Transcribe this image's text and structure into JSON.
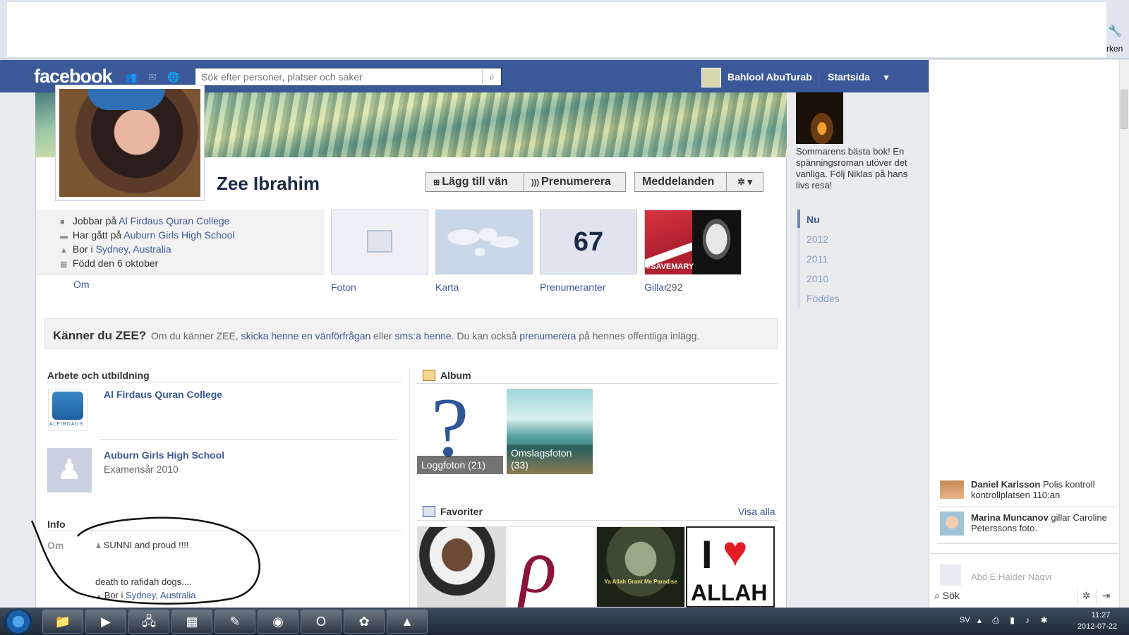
{
  "browser": {
    "wrench_icon": "wrench-icon",
    "partial_label": "rken"
  },
  "topbar": {
    "logo": "facebook",
    "search_placeholder": "Sök efter personer, platser och saker",
    "user_name": "Bahlool AbuTurab",
    "home": "Startsida",
    "brand_color": "#3b5998"
  },
  "profile": {
    "name": "Zee Ibrahim",
    "buttons": {
      "add_friend": "Lägg till vän",
      "subscribe": "Prenumerera",
      "messages": "Meddelanden"
    },
    "intro": [
      {
        "prefix": "Jobbar på ",
        "link": "Al Firdaus Quran College"
      },
      {
        "prefix": "Har gått på ",
        "link": "Auburn Girls High School"
      },
      {
        "prefix": "Bor i ",
        "link": "Sydney, Australia"
      },
      {
        "prefix": "Född den 6 oktober",
        "link": ""
      }
    ],
    "om_link": "Om",
    "tiles": {
      "photos": "Foton",
      "map": "Karta",
      "subscribers": "Prenumeranter",
      "subscribers_count": "67",
      "likes": "Gillar",
      "likes_count": "292",
      "likes_image_text": "#SAVEMARY"
    }
  },
  "know": {
    "title": "Känner du ZEE?",
    "t1": "Om du känner ZEE, ",
    "l1": "skicka henne en vänförfrågan",
    "t2": " eller ",
    "l2": "sms:a henne",
    "t3": ". Du kan också ",
    "l3": "prenumerera",
    "t4": " på hennes offentliga inlägg."
  },
  "work": {
    "title": "Arbete och utbildning",
    "items": [
      {
        "name": "Al Firdaus Quran College",
        "detail": "",
        "logo_text": "ALFIRDAUS"
      },
      {
        "name": "Auburn Girls High School",
        "detail": "Examensår 2010"
      }
    ]
  },
  "info": {
    "title": "Info",
    "key": "Om",
    "line1": "SUNNI and proud !!!!",
    "line2": "death to rafidah dogs....",
    "line3_prefix": "Bor i ",
    "line3_link": "Sydney, Australia"
  },
  "album": {
    "title": "Album",
    "items": [
      {
        "label": "Loggfoton (21)"
      },
      {
        "label_1": "Omslagsfoton",
        "label_2": "(33)"
      }
    ]
  },
  "favorites": {
    "title": "Favoriter",
    "see_all": "Visa alla",
    "fav3_text": "Ya Allah Grant Me Paradise",
    "fav4_text": "ALLAH"
  },
  "ad": {
    "text": "Sommarens bästa bok! En spänningsroman utöver det vanliga. Följ Niklas på hans livs resa!"
  },
  "timeline": [
    "Nu",
    "2012",
    "2011",
    "2010",
    "Föddes"
  ],
  "chat": {
    "items": [
      {
        "name": "Daniel Karlsson",
        "text": " Polis kontroll kontrollplatsen 110:an"
      },
      {
        "name": "Marina Muncanov",
        "text": " gillar Caroline Peterssons foto."
      }
    ],
    "ghost_name": "Abd E Haider Naqvi",
    "search": "Sök"
  },
  "taskbar": {
    "lang": "SV",
    "time": "11:27",
    "date": "2012-07-22"
  }
}
